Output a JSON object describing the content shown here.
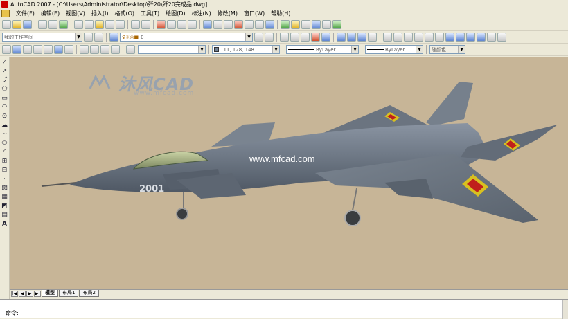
{
  "window": {
    "title": "AutoCAD 2007 - [C:\\Users\\Administrator\\Desktop\\歼20\\歼20完成品.dwg]"
  },
  "menu": {
    "items": [
      "文件(F)",
      "编辑(E)",
      "视图(V)",
      "插入(I)",
      "格式(O)",
      "工具(T)",
      "绘图(D)",
      "标注(N)",
      "修改(M)",
      "窗口(W)",
      "帮助(H)"
    ]
  },
  "toolbar": {
    "workspace_value": "我的工作空间",
    "layer_value": "0",
    "color_value": "111, 128, 148",
    "linetype_value": "ByLayer",
    "lineweight_value": "ByLayer",
    "plotstyle_value": "随颜色"
  },
  "canvas": {
    "background_color": "#c7b597",
    "watermark_text": "沐风CAD",
    "watermark_sub": "www.mfcad.com",
    "url_text": "www.mfcad.com",
    "aircraft_number": "2001",
    "aircraft_color": "#6d7784"
  },
  "layout_tabs": {
    "tabs": [
      "模型",
      "布局1",
      "布局2"
    ],
    "active": "模型"
  },
  "command": {
    "prompt": "命令:"
  }
}
